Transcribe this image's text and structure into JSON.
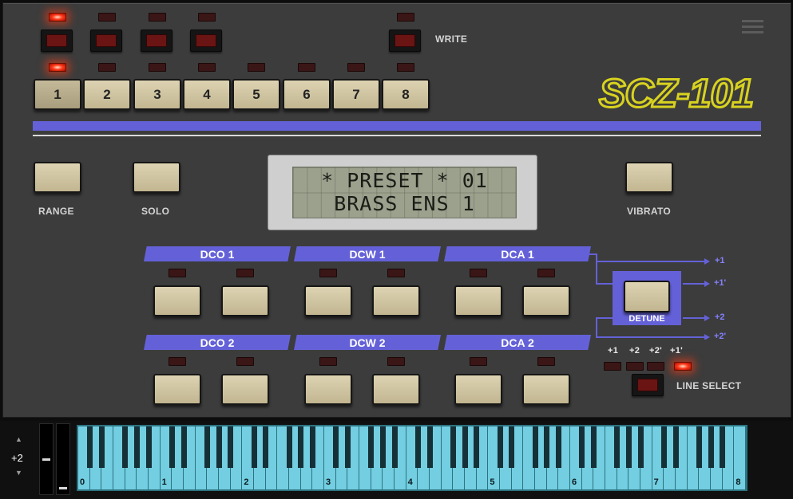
{
  "memory": {
    "bank_buttons": [
      {
        "led_on": true
      },
      {
        "led_on": false
      },
      {
        "led_on": false
      },
      {
        "led_on": false
      }
    ],
    "write_label": "WRITE",
    "program_buttons": [
      {
        "label": "1",
        "selected": true
      },
      {
        "label": "2",
        "selected": false
      },
      {
        "label": "3",
        "selected": false
      },
      {
        "label": "4",
        "selected": false
      },
      {
        "label": "5",
        "selected": false
      },
      {
        "label": "6",
        "selected": false
      },
      {
        "label": "7",
        "selected": false
      },
      {
        "label": "8",
        "selected": false
      }
    ]
  },
  "logo": "SCZ-101",
  "menu_icon": "hamburger-menu-icon",
  "controls": {
    "range_label": "RANGE",
    "solo_label": "SOLO",
    "vibrato_label": "VIBRATO",
    "detune_label": "DETUNE",
    "line_select_label": "LINE SELECT"
  },
  "display": {
    "line1": "* PRESET * 01",
    "line2": "BRASS ENS 1"
  },
  "sections": {
    "row1": [
      "DCO 1",
      "DCW 1",
      "DCA 1"
    ],
    "row2": [
      "DCO 2",
      "DCW 2",
      "DCA 2"
    ]
  },
  "lines": {
    "outputs": [
      "+1",
      "+1'",
      "+2",
      "+2'"
    ],
    "select": [
      {
        "label": "+1",
        "led_on": false
      },
      {
        "label": "+2",
        "led_on": false
      },
      {
        "label": "+2'",
        "led_on": false
      },
      {
        "label": "+1'",
        "led_on": true
      }
    ]
  },
  "keyboard": {
    "octave_shift": "+2",
    "octave_labels": [
      "0",
      "1",
      "2",
      "3",
      "4",
      "5",
      "6",
      "7",
      "8"
    ]
  },
  "colors": {
    "accent_stripe": "#6461d8",
    "logo": "#d8d21f",
    "keyboard_keys": "#72cee0",
    "led_on": "#ff3a1a"
  }
}
